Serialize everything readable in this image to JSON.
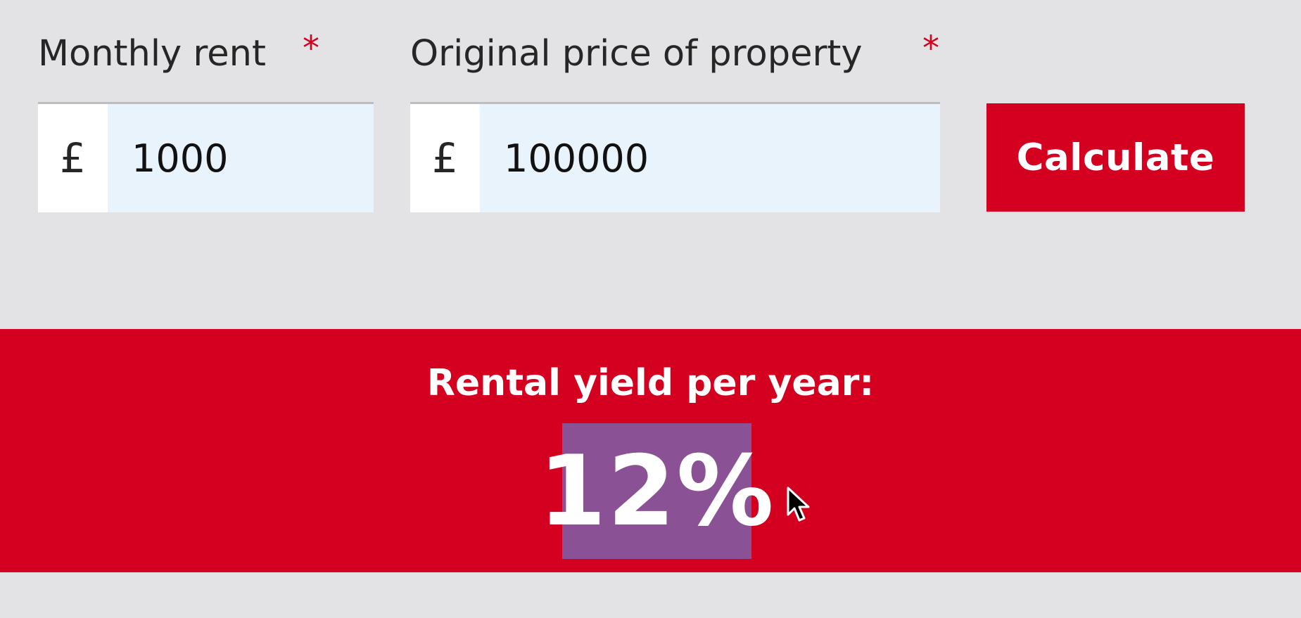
{
  "form": {
    "monthly_rent": {
      "label": "Monthly rent",
      "required_marker": "*",
      "currency_symbol": "£",
      "value": "1000"
    },
    "original_price": {
      "label": "Original price of property",
      "required_marker": "*",
      "currency_symbol": "£",
      "value": "100000"
    },
    "calculate_label": "Calculate"
  },
  "result": {
    "title": "Rental yield per year:",
    "value": "12%"
  },
  "colors": {
    "background": "#e3e3e5",
    "accent_red": "#d4001f",
    "input_fill": "#e8f3fc",
    "selection": "#8b5195",
    "text": "#262626"
  },
  "icons": {
    "cursor": "mouse-pointer-icon"
  }
}
